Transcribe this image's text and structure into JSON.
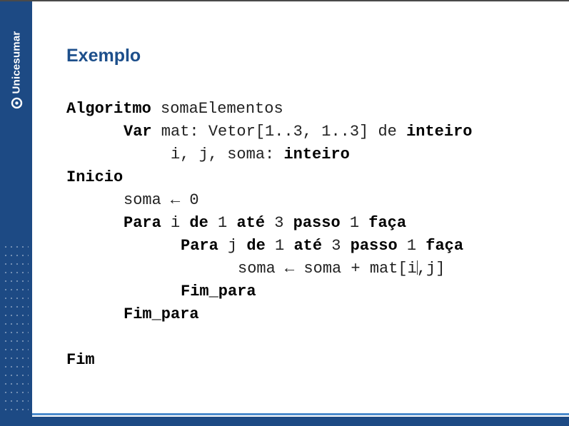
{
  "brand": {
    "name": "Unicesumar",
    "logo_icon": "unicesumar-logo-icon",
    "colors": {
      "primary": "#1d4a84",
      "title": "#1d4f8b",
      "accent_line": "#4b8bcc"
    }
  },
  "slide": {
    "title": "Exemplo"
  },
  "code": {
    "line1": {
      "kw": "Algoritmo",
      "rest": " somaElementos"
    },
    "line2": {
      "kw1": "Var",
      "mid": " mat: Vetor[1..3, 1..3] de ",
      "kw2": "inteiro"
    },
    "line3": {
      "mid": "i, j, soma: ",
      "kw": "inteiro"
    },
    "line4": {
      "kw": "Inicio"
    },
    "line5": {
      "text": "soma ← 0"
    },
    "line6": {
      "kw1": "Para",
      "t1": " i ",
      "kw2": "de",
      "t2": " 1 ",
      "kw3": "até",
      "t3": " 3 ",
      "kw4": "passo",
      "t4": " 1 ",
      "kw5": "faça"
    },
    "line7": {
      "kw1": "Para",
      "t1": " j ",
      "kw2": "de",
      "t2": " 1 ",
      "kw3": "até",
      "t3": " 3 ",
      "kw4": "passo",
      "t4": " 1 ",
      "kw5": "faça"
    },
    "line8": {
      "before_cursor": "soma ← soma + mat[i",
      "after_cursor": ",j]"
    },
    "line9": {
      "kw": "Fim_para"
    },
    "line10": {
      "kw": "Fim_para"
    },
    "line12": {
      "kw": "Fim"
    }
  }
}
